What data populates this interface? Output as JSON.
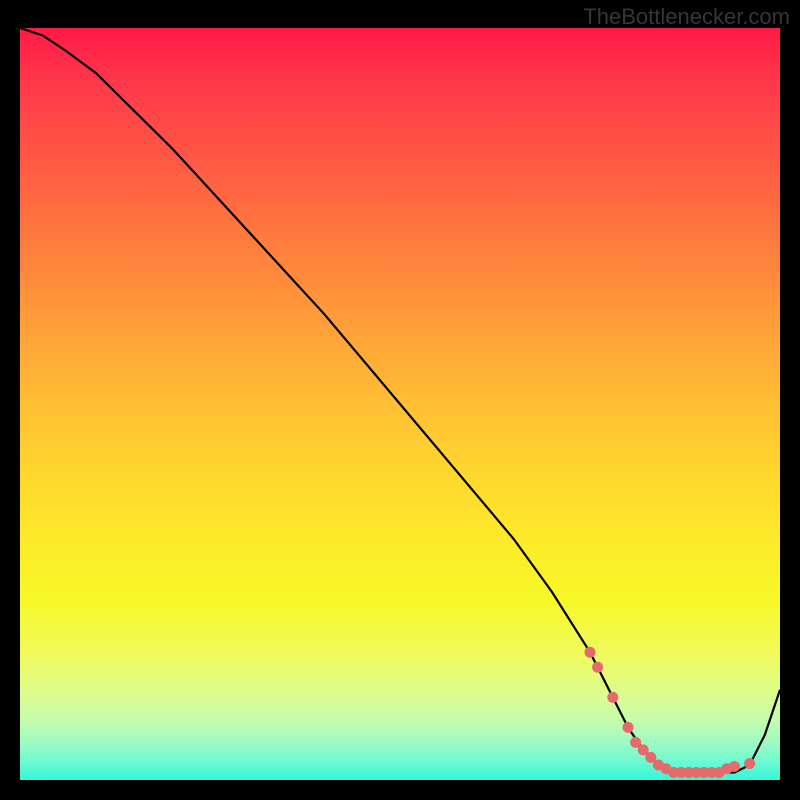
{
  "watermark": "TheBottlenecker.com",
  "chart_data": {
    "type": "line",
    "title": "",
    "xlabel": "",
    "ylabel": "",
    "xlim": [
      0,
      100
    ],
    "ylim": [
      0,
      100
    ],
    "series": [
      {
        "name": "curve",
        "x": [
          0,
          3,
          6,
          10,
          15,
          20,
          30,
          40,
          50,
          60,
          65,
          70,
          75,
          78,
          80,
          82,
          84,
          86,
          88,
          90,
          92,
          94,
          96,
          98,
          100
        ],
        "values": [
          100,
          99,
          97,
          94,
          89,
          84,
          73,
          62,
          50,
          38,
          32,
          25,
          17,
          11,
          7,
          4,
          2,
          1,
          1,
          1,
          1,
          1,
          2,
          6,
          12
        ]
      }
    ],
    "markers": {
      "name": "highlighted-points",
      "color": "#e56a6a",
      "x": [
        75,
        76,
        78,
        80,
        81,
        82,
        83,
        84,
        85,
        86,
        87,
        88,
        89,
        90,
        91,
        92,
        93,
        94,
        96
      ],
      "values": [
        17,
        15,
        11,
        7,
        5,
        4,
        3,
        2,
        1.5,
        1,
        1,
        1,
        1,
        1,
        1,
        1,
        1.5,
        1.8,
        2.2
      ]
    }
  }
}
